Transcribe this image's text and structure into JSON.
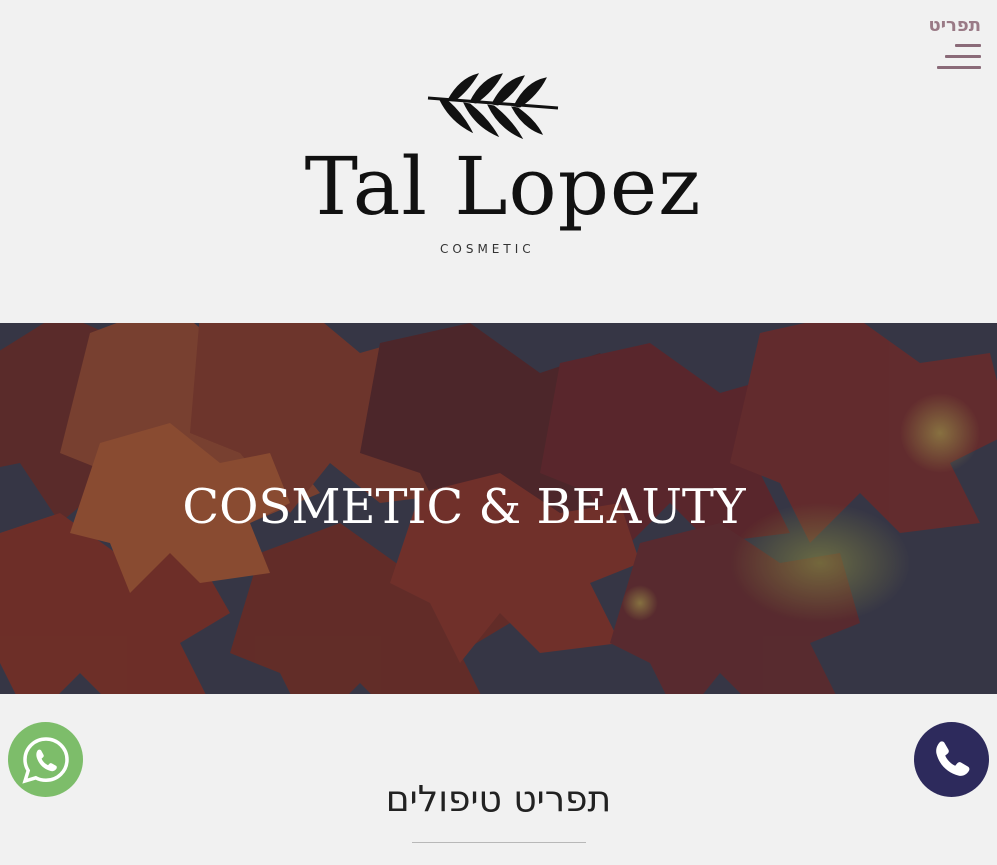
{
  "header": {
    "menu_label": "תפריט"
  },
  "logo": {
    "name": "Tal Lopez",
    "subtitle": "COSMETIC"
  },
  "hero": {
    "title": "COSMETIC & BEAUTY"
  },
  "contact": {
    "whatsapp_icon": "whatsapp-icon",
    "phone_icon": "phone-icon",
    "whatsapp_color": "#7dbd6a",
    "phone_color": "#2d2a5c"
  },
  "section": {
    "title": "תפריט טיפולים"
  },
  "colors": {
    "menu_accent": "#9a7a86",
    "background": "#f1f1f1"
  }
}
